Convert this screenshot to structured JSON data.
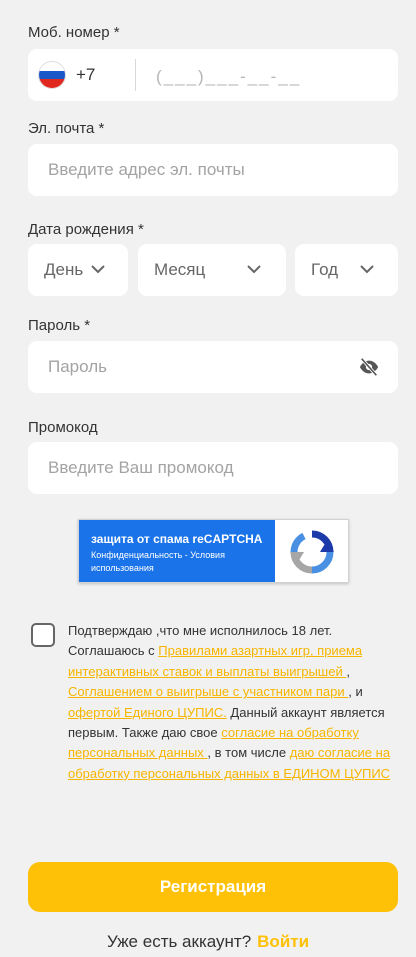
{
  "phone": {
    "label": "Моб. номер *",
    "country_code": "+7",
    "flag": "russia-flag",
    "mask": "(___)___-__-__"
  },
  "email": {
    "label": "Эл. почта *",
    "placeholder": "Введите адрес эл. почты"
  },
  "birthdate": {
    "label": "Дата рождения *",
    "day": "День",
    "month": "Месяц",
    "year": "Год"
  },
  "password": {
    "label": "Пароль *",
    "placeholder": "Пароль",
    "toggle_icon": "eye-off-icon"
  },
  "promo": {
    "label": "Промокод",
    "placeholder": "Введите Ваш промокод"
  },
  "recaptcha": {
    "title": "защита от спама reCAPTCHA",
    "subtitle": "Конфиденциальность - Условия использования"
  },
  "consent": {
    "t1": "Подтверждаю ,что мне исполнилось 18 лет. Соглашаюсь с ",
    "l1": "Правилами азартных игр, приема интерактивных ставок и выплаты выигрышей ",
    "t2": ", ",
    "l2": "Соглашением о выигрыше с участником пари ",
    "t3": ", и ",
    "l3": "офертой Единого ЦУПИС.",
    "t4": " Данный аккаунт является первым. Также даю свое ",
    "l4": "согласие на обработку персональных данных ",
    "t5": ", в том числе ",
    "l5": "даю согласие на обработку персональных данных в ЕДИНОМ ЦУПИС"
  },
  "register_button": "Регистрация",
  "footer": {
    "question": "Уже есть аккаунт?",
    "login_link": "Войти"
  },
  "colors": {
    "accent": "#ffc107",
    "link": "#f7b500",
    "background": "#f1f1f1",
    "recaptcha_blue": "#1a73e8"
  }
}
